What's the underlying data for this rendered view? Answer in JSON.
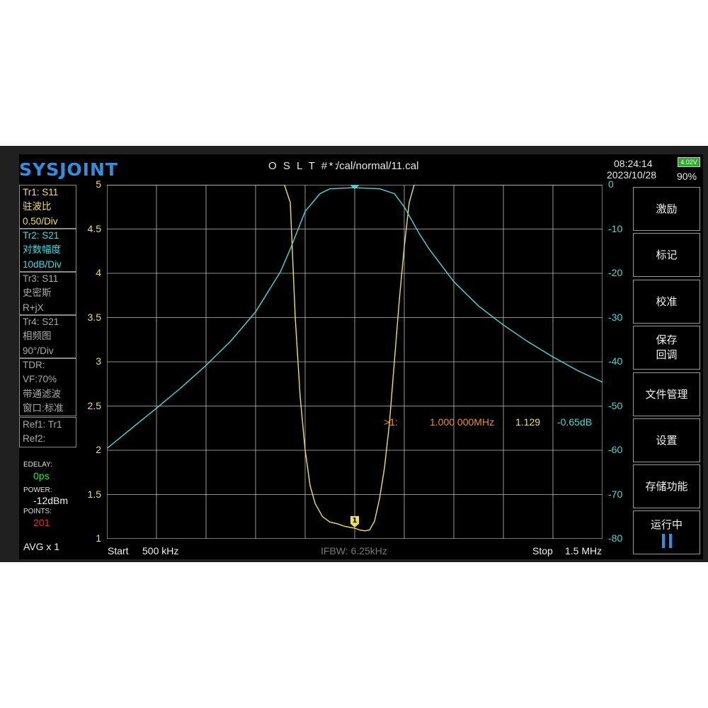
{
  "header": {
    "logo": "SYSJOINT",
    "cal_label": "O S L T #*:",
    "cal_file": "/cal/normal/11.cal",
    "time": "08:24:14",
    "date": "2023/10/28",
    "battery_voltage": "4.02V",
    "battery_percent": "90%"
  },
  "traces": {
    "tr1": {
      "name": "Tr1:  S11",
      "format": "驻波比",
      "scale": "0.50/Div"
    },
    "tr2": {
      "name": "Tr2:  S21",
      "format": "对数幅度",
      "scale": "10dB/Div"
    },
    "tr3": {
      "name": "Tr3:  S11",
      "format": "史密斯",
      "scale": "R+jX"
    },
    "tr4": {
      "name": "Tr4:  S21",
      "format": "相频图",
      "scale": "90°/Div"
    },
    "tdr": {
      "name": "TDR:",
      "vf": "VF:70%",
      "mode": "带通滤波",
      "window": "窗口:标准"
    },
    "ref": {
      "ref1": "Ref1:  Tr1",
      "ref2": "Ref2:"
    }
  },
  "status": {
    "edelay_label": "EDELAY:",
    "edelay_value": "0ps",
    "power_label": "POWER:",
    "power_value": "-12dBm",
    "points_label": "POINTS:",
    "points_value": "201",
    "avg": "AVG x 1"
  },
  "sweep": {
    "start_label": "Start",
    "start_value": "500 kHz",
    "ifbw": "IFBW: 6.25kHz",
    "stop_label": "Stop",
    "stop_value": "1.5 MHz"
  },
  "marker": {
    "id": "1",
    "label": ">1:",
    "freq": "1.000 000MHz",
    "swr": "1.129",
    "mag": "-0.65dB"
  },
  "softkeys": [
    {
      "label": "激励"
    },
    {
      "label": "标记"
    },
    {
      "label": "校准"
    },
    {
      "label": "保存\n回调"
    },
    {
      "label": "文件管理"
    },
    {
      "label": "设置"
    },
    {
      "label": "存储功能"
    },
    {
      "label": "运行中"
    }
  ],
  "colors": {
    "swr_trace": "#f0e060",
    "s21_trace": "#48d8d8",
    "marker": "#e89030",
    "logo": "#2f8fe0"
  },
  "chart_data": {
    "type": "line",
    "x_unit": "MHz",
    "xlim": [
      0.5,
      1.5
    ],
    "left_axis": {
      "ylim": [
        1,
        5
      ],
      "ticks": [
        "5",
        "4.5",
        "4",
        "3.5",
        "3",
        "2.5",
        "2",
        "1.5",
        "1"
      ]
    },
    "right_axis": {
      "ylim": [
        -80,
        0
      ],
      "ticks": [
        "0",
        "-10",
        "-20",
        "-30",
        "-40",
        "-50",
        "-60",
        "-70",
        "-80"
      ]
    },
    "grid": true,
    "series": [
      {
        "axis": "left",
        "x": [
          0.5,
          0.858,
          0.87,
          0.88,
          0.89,
          0.9,
          0.91,
          0.92,
          0.935,
          0.95,
          0.965,
          0.98,
          1.0,
          1.01,
          1.02,
          1.03,
          1.04,
          1.05,
          1.06,
          1.07,
          1.08,
          1.09,
          1.1,
          1.11,
          1.12,
          1.145,
          1.5
        ],
        "y": [
          5,
          5,
          4.8,
          3.5,
          2.6,
          2.0,
          1.6,
          1.4,
          1.25,
          1.19,
          1.17,
          1.14,
          1.12,
          1.1,
          1.09,
          1.1,
          1.2,
          1.45,
          1.8,
          2.3,
          3.0,
          3.7,
          4.3,
          4.8,
          5,
          5,
          5
        ]
      },
      {
        "axis": "right",
        "x": [
          0.5,
          0.55,
          0.6,
          0.65,
          0.7,
          0.75,
          0.8,
          0.85,
          0.87,
          0.9,
          0.93,
          0.95,
          1.0,
          1.05,
          1.08,
          1.1,
          1.13,
          1.15,
          1.2,
          1.25,
          1.3,
          1.35,
          1.4,
          1.45,
          1.5
        ],
        "y": [
          -59.6,
          -55,
          -50.5,
          -45.8,
          -40.8,
          -35.3,
          -28.7,
          -19.7,
          -14.5,
          -6,
          -2,
          -0.9,
          -0.65,
          -0.9,
          -2,
          -5,
          -11,
          -14.5,
          -21.9,
          -27.4,
          -31.7,
          -35.5,
          -38.9,
          -42,
          -44.6
        ]
      }
    ]
  }
}
